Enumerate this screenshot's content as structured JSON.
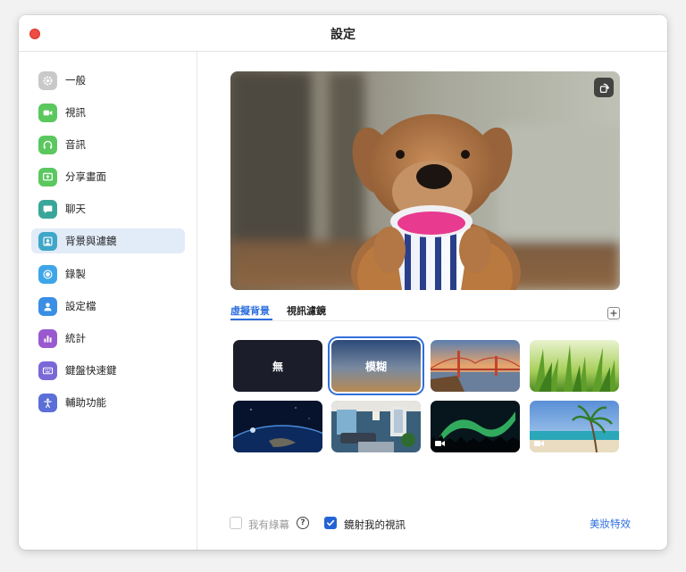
{
  "window": {
    "title": "設定"
  },
  "sidebar": {
    "items": [
      {
        "label": "一般",
        "icon": "gear-icon",
        "color": "#c9c9c9"
      },
      {
        "label": "視訊",
        "icon": "video-camera-icon",
        "color": "#5ac85e"
      },
      {
        "label": "音訊",
        "icon": "headphones-icon",
        "color": "#5ac85e"
      },
      {
        "label": "分享畫面",
        "icon": "share-screen-icon",
        "color": "#5ac85e"
      },
      {
        "label": "聊天",
        "icon": "chat-bubble-icon",
        "color": "#3aa699"
      },
      {
        "label": "背景與濾鏡",
        "icon": "portrait-background-icon",
        "color": "#3ea6c9",
        "active": true
      },
      {
        "label": "錄製",
        "icon": "record-icon",
        "color": "#3ea6e8"
      },
      {
        "label": "設定檔",
        "icon": "profile-icon",
        "color": "#3a8ee6"
      },
      {
        "label": "統計",
        "icon": "bar-chart-icon",
        "color": "#9b59d0"
      },
      {
        "label": "鍵盤快速鍵",
        "icon": "keyboard-icon",
        "color": "#7b68d8"
      },
      {
        "label": "輔助功能",
        "icon": "accessibility-icon",
        "color": "#5b6fd8"
      }
    ]
  },
  "tabs": {
    "virtual_background": "虛擬背景",
    "video_filters": "視訊濾鏡"
  },
  "backgrounds": [
    {
      "label": "無",
      "kind": "none"
    },
    {
      "label": "模糊",
      "kind": "blur",
      "selected": true
    },
    {
      "label": "",
      "kind": "golden-gate-bridge"
    },
    {
      "label": "",
      "kind": "grass"
    },
    {
      "label": "",
      "kind": "earth-from-space"
    },
    {
      "label": "",
      "kind": "living-room"
    },
    {
      "label": "",
      "kind": "aurora",
      "video": true
    },
    {
      "label": "",
      "kind": "beach-palm",
      "video": true
    }
  ],
  "footer": {
    "green_screen_label": "我有綠幕",
    "green_screen_checked": false,
    "help_symbol": "?",
    "mirror_label": "鏡射我的視訊",
    "mirror_checked": true,
    "beauty_link": "美妝特效"
  },
  "colors": {
    "accent": "#2d6fde",
    "close": "#ee4b43"
  }
}
